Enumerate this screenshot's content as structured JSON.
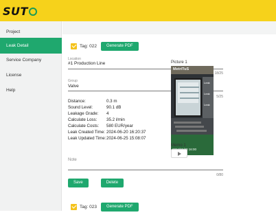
{
  "app": {
    "logo_text": "SUTO",
    "logo_prefix": "S",
    "brand_color": "#f6d21b",
    "accent_color": "#1fa86e"
  },
  "sidebar": {
    "items": [
      {
        "label": "Project"
      },
      {
        "label": "Leak Detail",
        "active": true
      },
      {
        "label": "Service Company"
      },
      {
        "label": "License"
      },
      {
        "label": "Help"
      }
    ]
  },
  "leak": {
    "tag_label": "Tag: 022",
    "generate_pdf_label": "Generate PDF",
    "location_label": "Location",
    "location_value": "#1 Production Line",
    "location_count": "18/25",
    "group_label": "Group",
    "group_value": "Valve",
    "group_count": "5/25",
    "info": [
      {
        "key": "Distance:",
        "value": "0.3 m"
      },
      {
        "key": "Sound Level:",
        "value": "90.1 dB"
      },
      {
        "key": "Leakage Grade:",
        "value": "4"
      },
      {
        "key": "Calculate Loss:",
        "value": "35.2 l/min"
      },
      {
        "key": "Calculate Costs:",
        "value": "580 EUR/year"
      },
      {
        "key": "Leak Created Time:",
        "value": "2024-06-20 16:20:37"
      },
      {
        "key": "Leak Updated Time:",
        "value": "2024-06-25 15:08:07"
      }
    ],
    "note_label": "Note",
    "note_count": "0/80",
    "save_label": "Save",
    "delete_label": "Delete",
    "picture_title": "Picture 1",
    "picture_brand": "MetriTuS",
    "picture_side_labels": [
      "Leak",
      "Leak",
      "Leak"
    ],
    "picture_date": "2024/06/20 16:00",
    "memo_title": "Memo 1"
  },
  "leak2": {
    "tag_label": "Tag: 023",
    "generate_pdf_label": "Generate PDF"
  }
}
